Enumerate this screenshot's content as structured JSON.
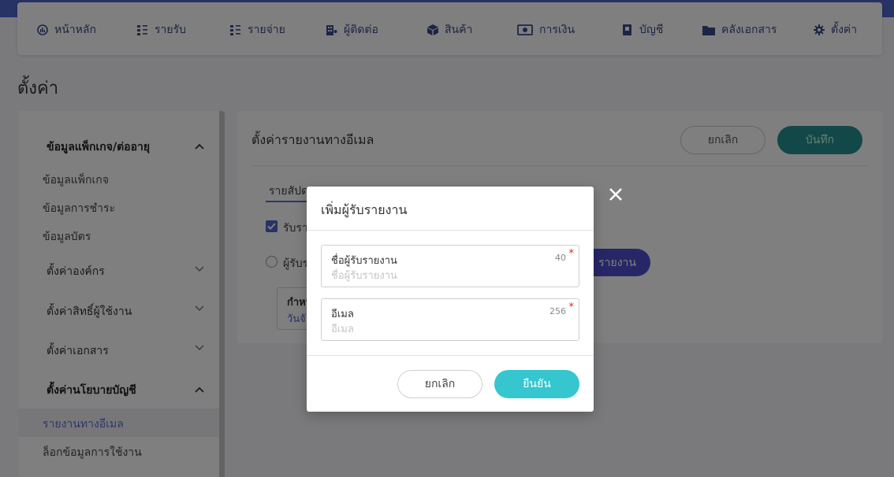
{
  "nav": {
    "items": [
      {
        "label": "หน้าหลัก",
        "icon": "dashboard-icon"
      },
      {
        "label": "รายรับ",
        "icon": "income-list-icon"
      },
      {
        "label": "รายจ่าย",
        "icon": "expense-list-icon"
      },
      {
        "label": "ผู้ติดต่อ",
        "icon": "contacts-icon"
      },
      {
        "label": "สินค้า",
        "icon": "box-icon"
      },
      {
        "label": "การเงิน",
        "icon": "money-icon"
      },
      {
        "label": "บัญชี",
        "icon": "book-icon"
      },
      {
        "label": "คลังเอกสาร",
        "icon": "folder-icon"
      },
      {
        "label": "ตั้งค่า",
        "icon": "gear-icon"
      }
    ]
  },
  "page": {
    "title": "ตั้งค่า"
  },
  "sidebar": {
    "groups": [
      {
        "label": "ข้อมูลแพ็กเกจ/ต่ออายุ",
        "expanded": true
      },
      {
        "label": "ตั้งค่าองค์กร",
        "expanded": false
      },
      {
        "label": "ตั้งค่าสิทธิ์ผู้ใช้งาน",
        "expanded": false
      },
      {
        "label": "ตั้งค่าเอกสาร",
        "expanded": false
      },
      {
        "label": "ตั้งค่านโยบายบัญชี",
        "expanded": true
      }
    ],
    "items": [
      {
        "label": "ข้อมูลแพ็กเกจ"
      },
      {
        "label": "ข้อมูลการชำระ"
      },
      {
        "label": "ข้อมูลบัตร"
      },
      {
        "label": "รายงานทางอีเมล"
      },
      {
        "label": "ล็อกข้อมูลการใช้งาน"
      }
    ]
  },
  "main": {
    "title": "ตั้งค่ารายงานทางอีเมล",
    "cancel_label": "ยกเลิก",
    "save_label": "บันทึก",
    "tab_label": "รายสัปดา",
    "checkbox_label": "รับรา",
    "radio_label": "ผู้รับร",
    "add_button_label": "รายงาน",
    "box_label": "กำหน",
    "box_link": "วันจั"
  },
  "modal": {
    "title": "เพิ่มผู้รับรายงาน",
    "fields": [
      {
        "label": "ชื่อผู้รับรายงาน",
        "counter": "40",
        "required": "*",
        "placeholder": "ชื่อผู้รับรายงาน",
        "value": ""
      },
      {
        "label": "อีเมล",
        "counter": "256",
        "required": "*",
        "placeholder": "อีเมล",
        "value": ""
      }
    ],
    "cancel_label": "ยกเลิก",
    "confirm_label": "ยืนยัน"
  },
  "colors": {
    "brand": "#4f66c9",
    "teal": "#25918f",
    "confirm": "#35c6cf",
    "active_text": "#5b6ed1",
    "required": "#e02424"
  }
}
